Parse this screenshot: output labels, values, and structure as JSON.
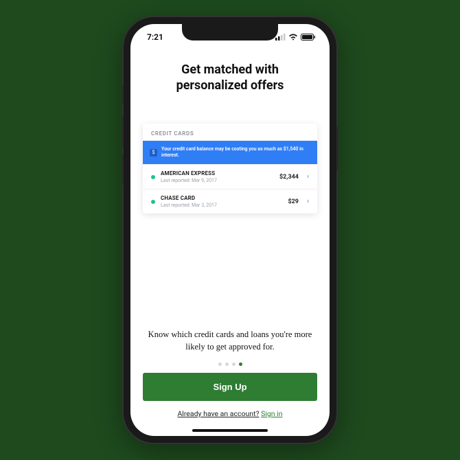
{
  "statusbar": {
    "time": "7:21"
  },
  "headline_line1": "Get matched with",
  "headline_line2": "personalized offers",
  "card": {
    "header": "CREDIT CARDS",
    "banner_icon": "$",
    "banner_text": "Your credit card balance may be costing you as much as $1,540 in interest.",
    "rows": [
      {
        "name": "AMERICAN EXPRESS",
        "sub": "Last reported: Mar 9, 2017",
        "amount": "$2,344"
      },
      {
        "name": "CHASE CARD",
        "sub": "Last reported: Mar 3, 2017",
        "amount": "$29"
      }
    ]
  },
  "subtext": "Know which credit cards and loans you're more likely to get approved for.",
  "pager": {
    "count": 4,
    "active_index": 3
  },
  "cta_label": "Sign Up",
  "signin_question": "Already have an account?",
  "signin_link": "Sign in"
}
